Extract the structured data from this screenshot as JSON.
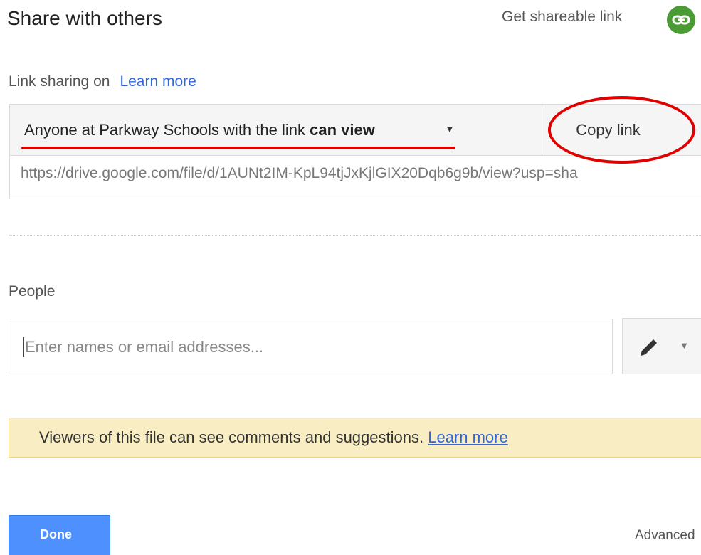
{
  "dialog": {
    "title": "Share with others",
    "get_link_label": "Get shareable link"
  },
  "link_sharing": {
    "status": "Link sharing on",
    "learn_more": "Learn more",
    "access_prefix": "Anyone at Parkway Schools with the link ",
    "access_level": "can view",
    "copy_label": "Copy link",
    "url": "https://drive.google.com/file/d/1AUNt2IM-KpL94tjJxKjlGIX20Dqb6g9b/view?usp=sha"
  },
  "people": {
    "label": "People",
    "placeholder": "Enter names or email addresses..."
  },
  "notice": {
    "text": "Viewers of this file can see comments and suggestions. ",
    "learn_more": "Learn more"
  },
  "footer": {
    "done_label": "Done",
    "advanced_label": "Advanced"
  },
  "icons": {
    "link": "link-icon",
    "dropdown": "caret-down-icon",
    "edit": "pencil-icon"
  },
  "colors": {
    "accent_blue": "#4d90fe",
    "link_blue": "#3367d6",
    "link_icon_green": "#4a9b33",
    "notice_background": "#f9eec3",
    "annotation_red": "#e00000"
  }
}
